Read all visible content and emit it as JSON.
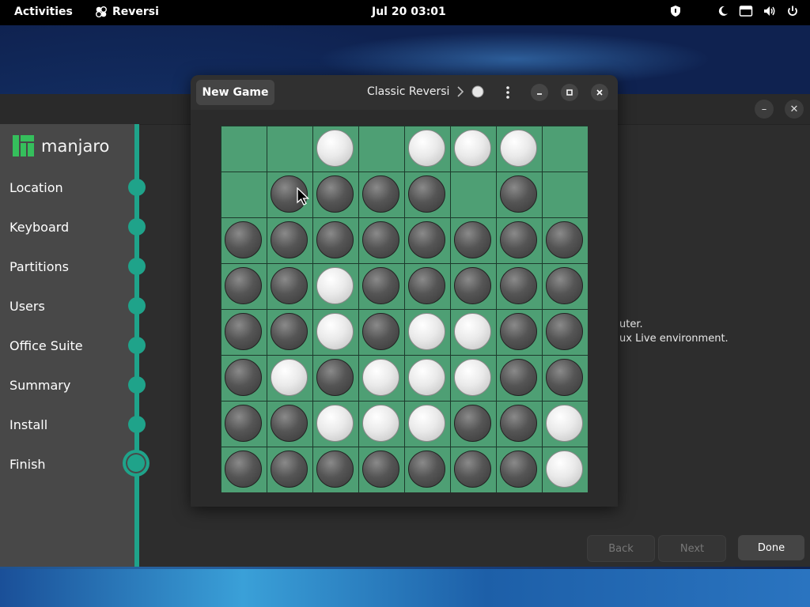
{
  "topbar": {
    "activities": "Activities",
    "app_name": "Reversi",
    "clock": "Jul 20  03:01"
  },
  "installer": {
    "logo_text": "manjaro",
    "steps": [
      "Location",
      "Keyboard",
      "Partitions",
      "Users",
      "Office Suite",
      "Summary",
      "Install",
      "Finish"
    ],
    "current_step": "Finish",
    "partial_text_1": "uter.",
    "partial_text_2": "ux Live environment.",
    "buttons": {
      "back": "Back",
      "next": "Next",
      "done": "Done"
    },
    "accent": "#1fa38a"
  },
  "reversi": {
    "new_game": "New Game",
    "title": "Classic Reversi",
    "turn_indicator": "white",
    "board": [
      "..W.WWW.",
      ".BBBB.B.",
      "BBBBBBBB",
      "BBWBBBBB",
      "BBWBWWBB",
      "BWBWWWBB",
      "BBWWWBBW",
      "BBBBBBBW"
    ],
    "board_color": "#4e9f74"
  }
}
